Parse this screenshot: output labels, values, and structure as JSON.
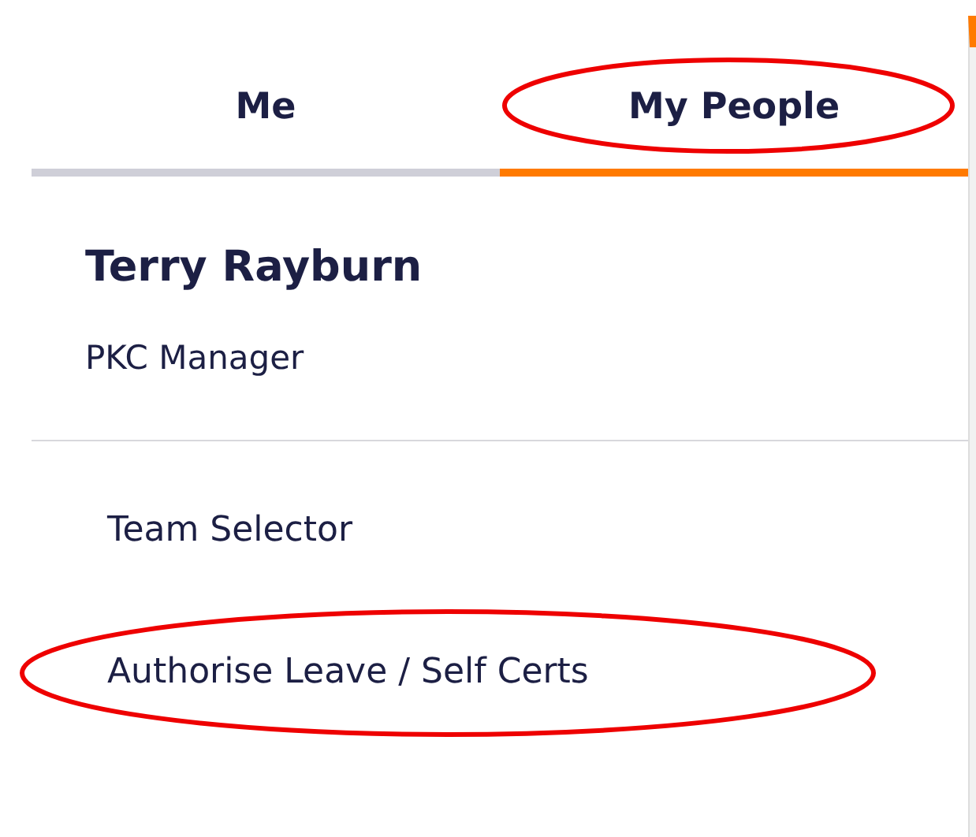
{
  "tabs": [
    {
      "label": "Me",
      "selected": false,
      "circled": false
    },
    {
      "label": "My People",
      "selected": true,
      "circled": true
    }
  ],
  "profile": {
    "name": "Terry Rayburn",
    "role": "PKC Manager"
  },
  "menu": [
    {
      "label": "Team Selector",
      "circled": false
    },
    {
      "label": "Authorise Leave / Self Certs",
      "circled": true
    }
  ]
}
